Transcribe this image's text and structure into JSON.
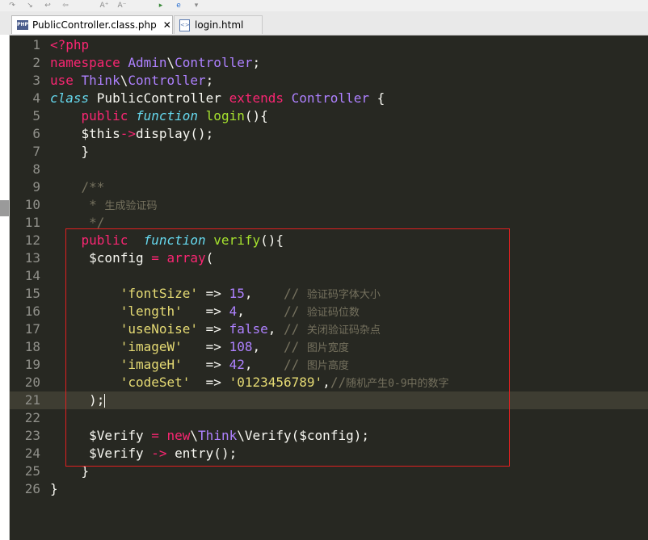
{
  "toolbar": {
    "icons": [
      "step-over-icon",
      "step-into-icon",
      "step-return-icon",
      "back-icon",
      "increase-font-icon",
      "decrease-font-icon",
      "run-icon",
      "browser-icon",
      "bookmark-icon"
    ],
    "font_up": "A⁺",
    "font_down": "A⁻"
  },
  "tabs": [
    {
      "label": "PublicController.class.php",
      "icon": "php-file-icon",
      "active": true
    },
    {
      "label": "login.html",
      "icon": "html-file-icon",
      "active": false
    }
  ],
  "colors": {
    "background": "#272822",
    "keyword": "#f92672",
    "type": "#ae81ff",
    "function": "#a6e22e",
    "italic_keyword": "#66d9ef",
    "string": "#e6db74",
    "comment": "#75715e",
    "plain": "#f8f8f2",
    "highlight_box": "#e02020"
  },
  "editor": {
    "current_line": 21,
    "lines": [
      {
        "n": "1",
        "t": [
          [
            "kw",
            "<?php"
          ]
        ]
      },
      {
        "n": "2",
        "t": [
          [
            "kw",
            "namespace "
          ],
          [
            "type",
            "Admin"
          ],
          [
            "pl",
            "\\"
          ],
          [
            "type",
            "Controller"
          ],
          [
            "pl",
            ";"
          ]
        ]
      },
      {
        "n": "3",
        "t": [
          [
            "kw",
            "use "
          ],
          [
            "type",
            "Think"
          ],
          [
            "pl",
            "\\"
          ],
          [
            "type",
            "Controller"
          ],
          [
            "pl",
            ";"
          ]
        ]
      },
      {
        "n": "4",
        "t": [
          [
            "it",
            "class "
          ],
          [
            "pl",
            "PublicController "
          ],
          [
            "kw",
            "extends "
          ],
          [
            "type",
            "Controller"
          ],
          [
            "pl",
            " {"
          ]
        ]
      },
      {
        "n": "5",
        "t": [
          [
            "pl",
            "    "
          ],
          [
            "kw",
            "public "
          ],
          [
            "it",
            "function "
          ],
          [
            "fn",
            "login"
          ],
          [
            "pl",
            "(){"
          ]
        ]
      },
      {
        "n": "6",
        "t": [
          [
            "pl",
            "    $this"
          ],
          [
            "kw",
            "->"
          ],
          [
            "pl",
            "display();"
          ]
        ]
      },
      {
        "n": "7",
        "t": [
          [
            "pl",
            "    }"
          ]
        ]
      },
      {
        "n": "8",
        "t": []
      },
      {
        "n": "9",
        "t": [
          [
            "cm",
            "    /**"
          ]
        ]
      },
      {
        "n": "10",
        "t": [
          [
            "cm",
            "     * "
          ],
          [
            "cmf",
            "生成验证码"
          ]
        ]
      },
      {
        "n": "11",
        "t": [
          [
            "cm",
            "     */"
          ]
        ]
      },
      {
        "n": "12",
        "t": [
          [
            "pl",
            "    "
          ],
          [
            "kw",
            "public  "
          ],
          [
            "it",
            "function "
          ],
          [
            "fn",
            "verify"
          ],
          [
            "pl",
            "(){"
          ]
        ]
      },
      {
        "n": "13",
        "t": [
          [
            "pl",
            "     $config "
          ],
          [
            "kw",
            "= "
          ],
          [
            "kw",
            "array"
          ],
          [
            "pl",
            "("
          ]
        ]
      },
      {
        "n": "14",
        "t": []
      },
      {
        "n": "15",
        "t": [
          [
            "pl",
            "         "
          ],
          [
            "str",
            "'fontSize'"
          ],
          [
            "pl",
            " => "
          ],
          [
            "type",
            "15"
          ],
          [
            "pl",
            ",    "
          ],
          [
            "cm",
            "// "
          ],
          [
            "cmf",
            "验证码字体大小"
          ]
        ]
      },
      {
        "n": "16",
        "t": [
          [
            "pl",
            "         "
          ],
          [
            "str",
            "'length'"
          ],
          [
            "pl",
            "   => "
          ],
          [
            "type",
            "4"
          ],
          [
            "pl",
            ",     "
          ],
          [
            "cm",
            "// "
          ],
          [
            "cmf",
            "验证码位数"
          ]
        ]
      },
      {
        "n": "17",
        "t": [
          [
            "pl",
            "         "
          ],
          [
            "str",
            "'useNoise'"
          ],
          [
            "pl",
            " => "
          ],
          [
            "type",
            "false"
          ],
          [
            "pl",
            ", "
          ],
          [
            "cm",
            "// "
          ],
          [
            "cmf",
            "关闭验证码杂点"
          ]
        ]
      },
      {
        "n": "18",
        "t": [
          [
            "pl",
            "         "
          ],
          [
            "str",
            "'imageW'"
          ],
          [
            "pl",
            "   => "
          ],
          [
            "type",
            "108"
          ],
          [
            "pl",
            ",   "
          ],
          [
            "cm",
            "// "
          ],
          [
            "cmf",
            "图片宽度"
          ]
        ]
      },
      {
        "n": "19",
        "t": [
          [
            "pl",
            "         "
          ],
          [
            "str",
            "'imageH'"
          ],
          [
            "pl",
            "   => "
          ],
          [
            "type",
            "42"
          ],
          [
            "pl",
            ",    "
          ],
          [
            "cm",
            "// "
          ],
          [
            "cmf",
            "图片高度"
          ]
        ]
      },
      {
        "n": "20",
        "t": [
          [
            "pl",
            "         "
          ],
          [
            "str",
            "'codeSet'"
          ],
          [
            "pl",
            "  => "
          ],
          [
            "str",
            "'0123456789'"
          ],
          [
            "pl",
            ","
          ],
          [
            "cm",
            "//"
          ],
          [
            "cmf",
            "随机产生0-9中的数字"
          ]
        ]
      },
      {
        "n": "21",
        "t": [
          [
            "pl",
            "     );"
          ],
          [
            "caret",
            ""
          ]
        ]
      },
      {
        "n": "22",
        "t": []
      },
      {
        "n": "23",
        "t": [
          [
            "pl",
            "     $Verify "
          ],
          [
            "kw",
            "= "
          ],
          [
            "kw",
            "new"
          ],
          [
            "pl",
            "\\"
          ],
          [
            "type",
            "Think"
          ],
          [
            "pl",
            "\\Verify($config);"
          ]
        ]
      },
      {
        "n": "24",
        "t": [
          [
            "pl",
            "     $Verify "
          ],
          [
            "kw",
            "-> "
          ],
          [
            "pl",
            "entry();"
          ]
        ]
      },
      {
        "n": "25",
        "t": [
          [
            "pl",
            "    }"
          ]
        ]
      },
      {
        "n": "26",
        "t": [
          [
            "pl",
            "}"
          ]
        ]
      }
    ]
  }
}
